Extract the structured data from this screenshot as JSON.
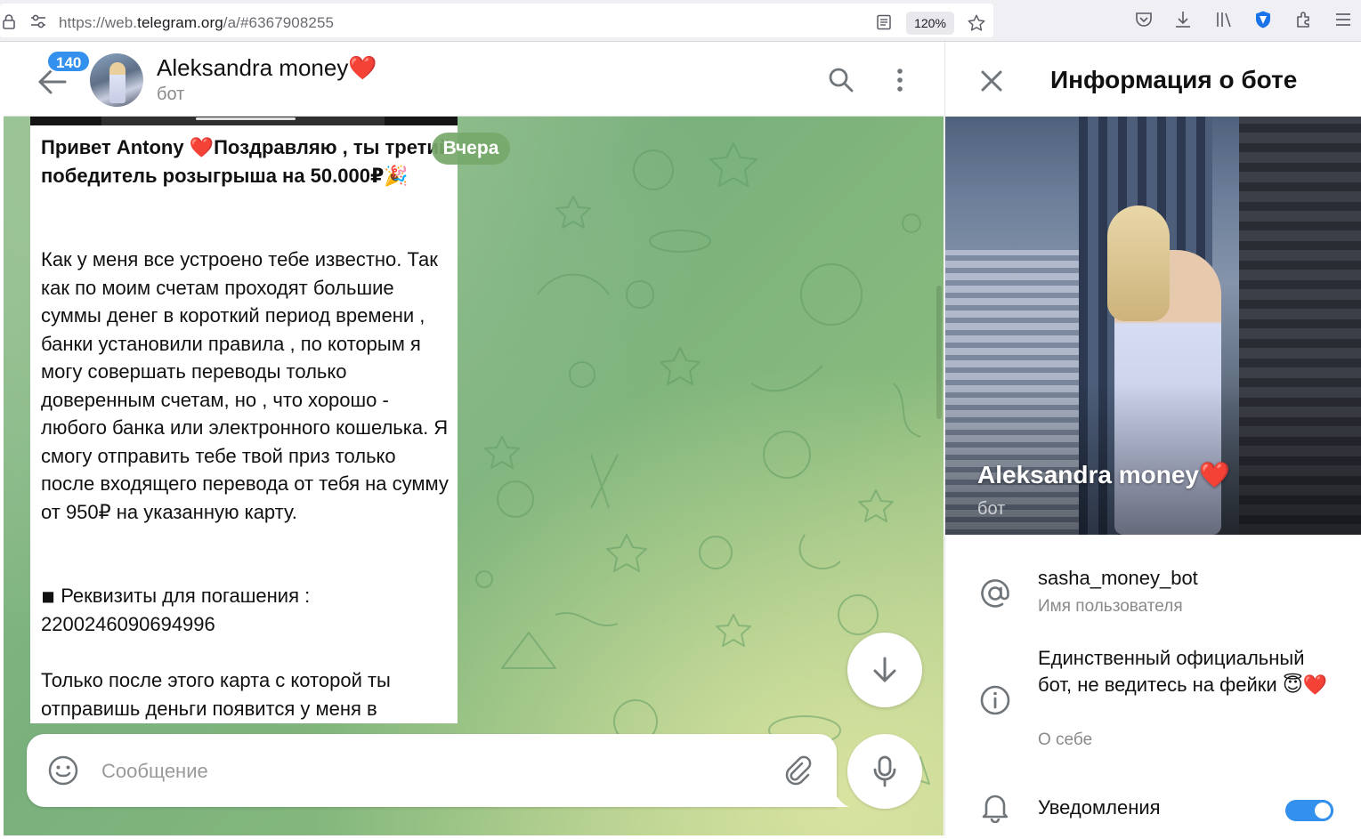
{
  "browser": {
    "url_scheme": "https://web.",
    "url_host": "telegram.org",
    "url_path": "/a/#6367908255",
    "zoom": "120%"
  },
  "chat": {
    "unread_count": "140",
    "title": "Aleksandra money",
    "title_emoji": "❤️",
    "subtitle": "бот",
    "date_label": "Вчера",
    "message": {
      "p1": "Привет Antony ❤️Поздравляю , ты третий победитель розыгрыша на 50.000₽🎉",
      "p2": "Как у меня все устроено тебе известно. Так как  по моим счетам проходят большие суммы денег в короткий период времени , банки установили правила , по которым я могу совершать переводы только доверенным счетам, но , что хорошо - любого банка или электронного кошелька. Я смогу отправить тебе твой приз только после входящего перевода от тебя на сумму от 950₽ на указанную  карту.",
      "p3": "◾ Реквизиты для погашения : 2200246090694996",
      "p4": "Только после этого карта с которой ты отправишь деньги появится у меня в"
    },
    "composer_placeholder": "Сообщение"
  },
  "panel": {
    "title": "Информация о боте",
    "name": "Aleksandra money",
    "name_emoji": "❤️",
    "sub": "бот",
    "username": "sasha_money_bot",
    "username_label": "Имя пользователя",
    "bio": "Единственный официальный бот, не ведитесь на фейки 😇❤️",
    "bio_label": "О себе",
    "notifications_label": "Уведомления",
    "notifications_on": true
  },
  "colors": {
    "accent": "#3390ec",
    "heart": "#e0182d",
    "chat_bg": "#86b97d"
  }
}
